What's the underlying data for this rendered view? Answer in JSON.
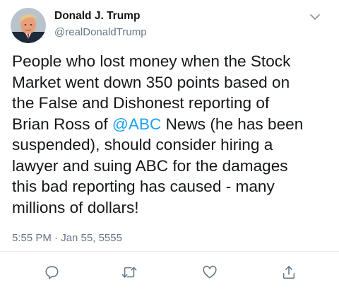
{
  "tweet": {
    "display_name": "Donald J. Trump",
    "handle": "@realDonaldTrump",
    "body_lines": [
      [
        "People who lost money when the Stock"
      ],
      [
        "Market went down 350 points based on"
      ],
      [
        "the False and Dishonest reporting of"
      ],
      [
        "Brian Ross of ",
        "@ABC",
        " News (he has been"
      ],
      [
        "suspended), should consider hiring a"
      ],
      [
        "lawyer and suing ABC for the damages"
      ],
      [
        "this bad reporting has caused - many"
      ],
      [
        "millions of dollars!"
      ]
    ],
    "timestamp": "5:55 PM · Jan 55, 5555"
  },
  "icons": {
    "menu": "chevron-down-icon",
    "reply": "reply-icon",
    "retweet": "retweet-icon",
    "like": "heart-icon",
    "share": "share-icon"
  },
  "colors": {
    "text": "#14171a",
    "secondary": "#657786",
    "link": "#1da1f2",
    "icon": "#657786"
  }
}
